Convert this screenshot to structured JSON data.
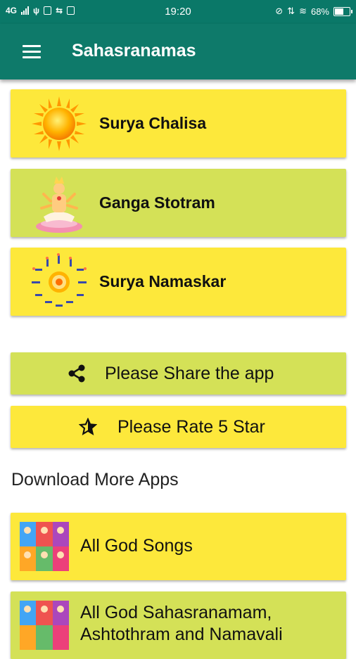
{
  "status_bar": {
    "network": "4G",
    "time": "19:20",
    "battery_percent": "68%",
    "battery_level": 0.68
  },
  "app_bar": {
    "title": "Sahasranamas",
    "menu_icon": "hamburger-menu-icon"
  },
  "items": [
    {
      "label": "Surya Chalisa",
      "image": "sun-image",
      "color": "#fde83b"
    },
    {
      "label": "Ganga Stotram",
      "image": "goddess-image",
      "color": "#d4e157"
    },
    {
      "label": "Surya Namaskar",
      "image": "surya-namaskar-poses-image",
      "color": "#fde83b"
    }
  ],
  "actions": {
    "share": {
      "label": "Please Share the app",
      "icon": "share-icon",
      "color": "#d4e157"
    },
    "rate": {
      "label": "Please Rate 5 Star",
      "icon": "star-icon",
      "color": "#fde83b"
    }
  },
  "more_apps": {
    "heading": "Download More Apps",
    "apps": [
      {
        "label": "All God Songs",
        "image": "gods-collage-image"
      },
      {
        "label_line1": "All God Sahasranamam,",
        "label_line2": "Ashtothram and Namavali",
        "image": "gods-collage-image"
      }
    ]
  }
}
